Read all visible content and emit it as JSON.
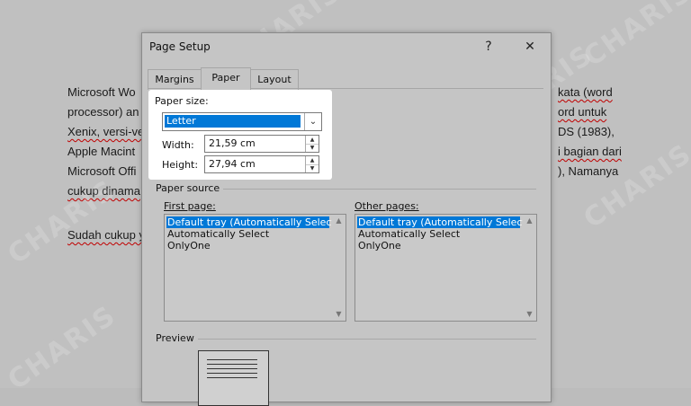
{
  "document": {
    "lines": [
      "Microsoft Wo",
      "processor) an",
      "Xenix, versi-ve",
      "Apple Macint",
      "Microsoft Offi",
      "cukup dinama",
      "Sudah cukup y"
    ],
    "right_lines": [
      "kata (word",
      "ord untuk",
      "DS (1983),",
      "i bagian dari",
      "), Namanya"
    ]
  },
  "watermark": "CHARIS",
  "dialog": {
    "title": "Page Setup",
    "help_label": "?",
    "close_label": "✕",
    "tabs": [
      {
        "label": "Margins",
        "active": false
      },
      {
        "label": "Paper",
        "active": true
      },
      {
        "label": "Layout",
        "active": false
      }
    ],
    "paper_size": {
      "label": "Paper size:",
      "value": "Letter",
      "width_label": "Width:",
      "width_value": "21,59 cm",
      "height_label": "Height:",
      "height_value": "27,94 cm"
    },
    "paper_source": {
      "label": "Paper source",
      "first_page_label": "First page:",
      "other_pages_label": "Other pages:",
      "first_page_items": [
        "Default tray (Automatically Select)",
        "Automatically Select",
        "OnlyOne"
      ],
      "other_pages_items": [
        "Default tray (Automatically Select)",
        "Automatically Select",
        "OnlyOne"
      ],
      "selected_index": 0
    },
    "preview_label": "Preview"
  }
}
